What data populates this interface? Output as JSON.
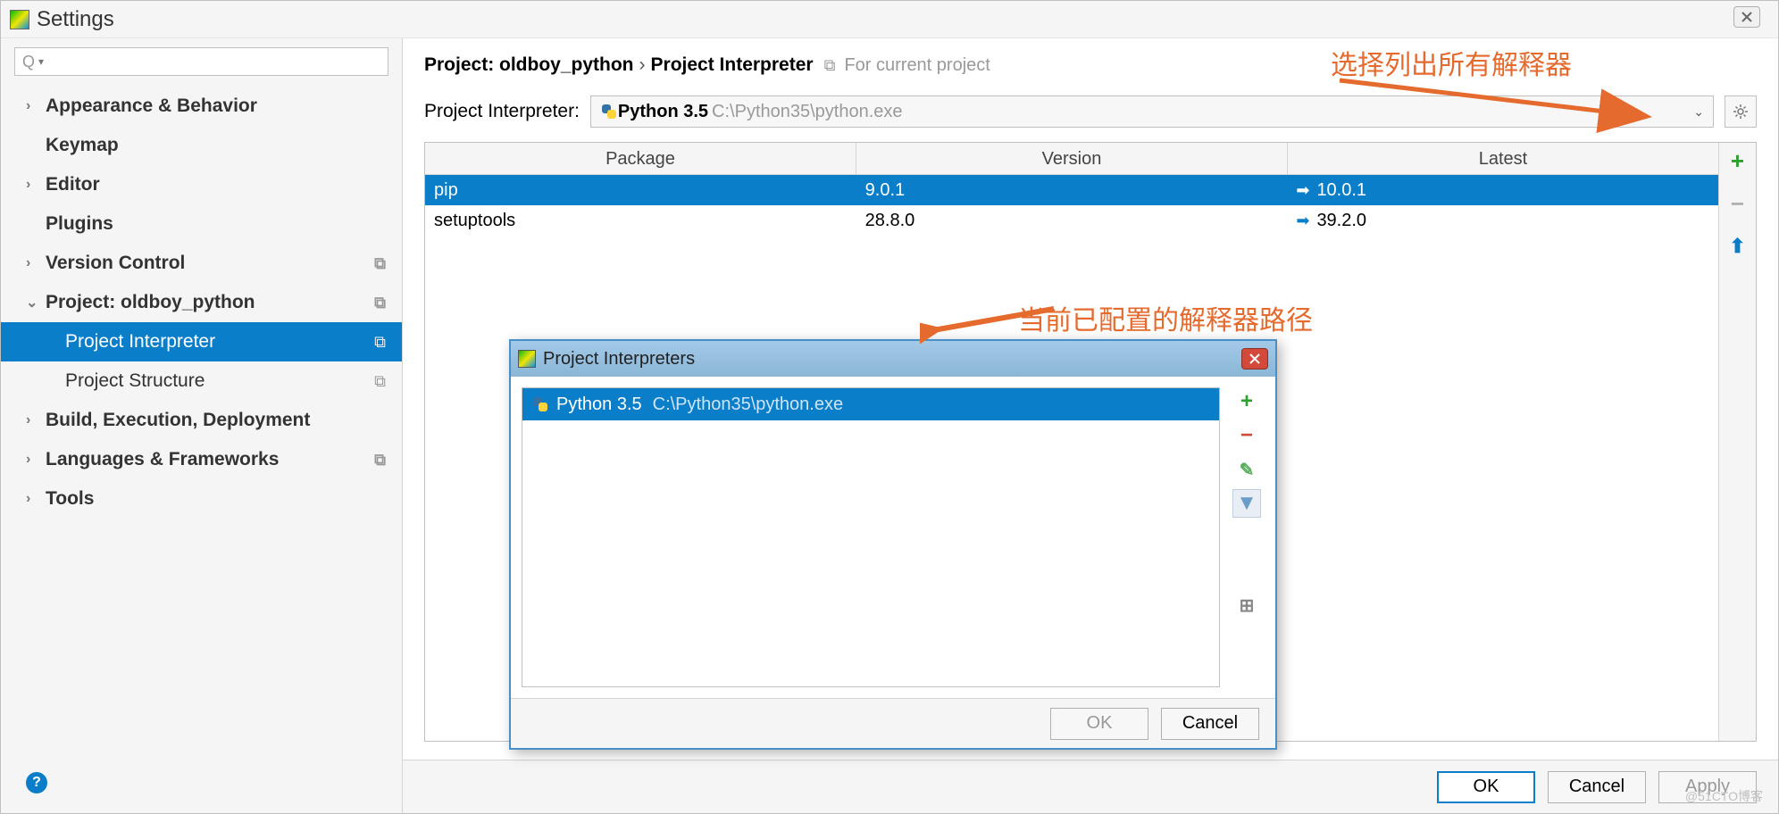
{
  "window": {
    "title": "Settings"
  },
  "sidebar": {
    "items": [
      {
        "label": "Appearance & Behavior",
        "bold": true,
        "chevron": true
      },
      {
        "label": "Keymap",
        "bold": true,
        "chevron": false
      },
      {
        "label": "Editor",
        "bold": true,
        "chevron": true
      },
      {
        "label": "Plugins",
        "bold": true,
        "chevron": false
      },
      {
        "label": "Version Control",
        "bold": true,
        "chevron": true,
        "copy": true
      },
      {
        "label": "Project: oldboy_python",
        "bold": true,
        "chevron": true,
        "expanded": true,
        "copy": true
      },
      {
        "label": "Project Interpreter",
        "child": true,
        "selected": true,
        "copy": true
      },
      {
        "label": "Project Structure",
        "child": true,
        "copy": true
      },
      {
        "label": "Build, Execution, Deployment",
        "bold": true,
        "chevron": true
      },
      {
        "label": "Languages & Frameworks",
        "bold": true,
        "chevron": true,
        "copy": true
      },
      {
        "label": "Tools",
        "bold": true,
        "chevron": true
      }
    ]
  },
  "breadcrumb": {
    "part1": "Project: oldboy_python",
    "sep": "›",
    "part2": "Project Interpreter",
    "hint": "For current project"
  },
  "interpreter": {
    "label": "Project Interpreter:",
    "selected_name": "Python 3.5",
    "selected_path": "C:\\Python35\\python.exe"
  },
  "packages": {
    "headers": [
      "Package",
      "Version",
      "Latest"
    ],
    "rows": [
      {
        "name": "pip",
        "version": "9.0.1",
        "latest": "10.0.1",
        "selected": true,
        "upgrade": true
      },
      {
        "name": "setuptools",
        "version": "28.8.0",
        "latest": "39.2.0",
        "upgrade": true
      }
    ]
  },
  "dialog": {
    "title": "Project Interpreters",
    "item_name": "Python 3.5",
    "item_path": "C:\\Python35\\python.exe",
    "ok": "OK",
    "cancel": "Cancel"
  },
  "buttons": {
    "ok": "OK",
    "cancel": "Cancel",
    "apply": "Apply"
  },
  "annotations": {
    "a1": "选择列出所有解释器",
    "a2": "当前已配置的解释器路径"
  },
  "watermark": "@51CTO博客"
}
